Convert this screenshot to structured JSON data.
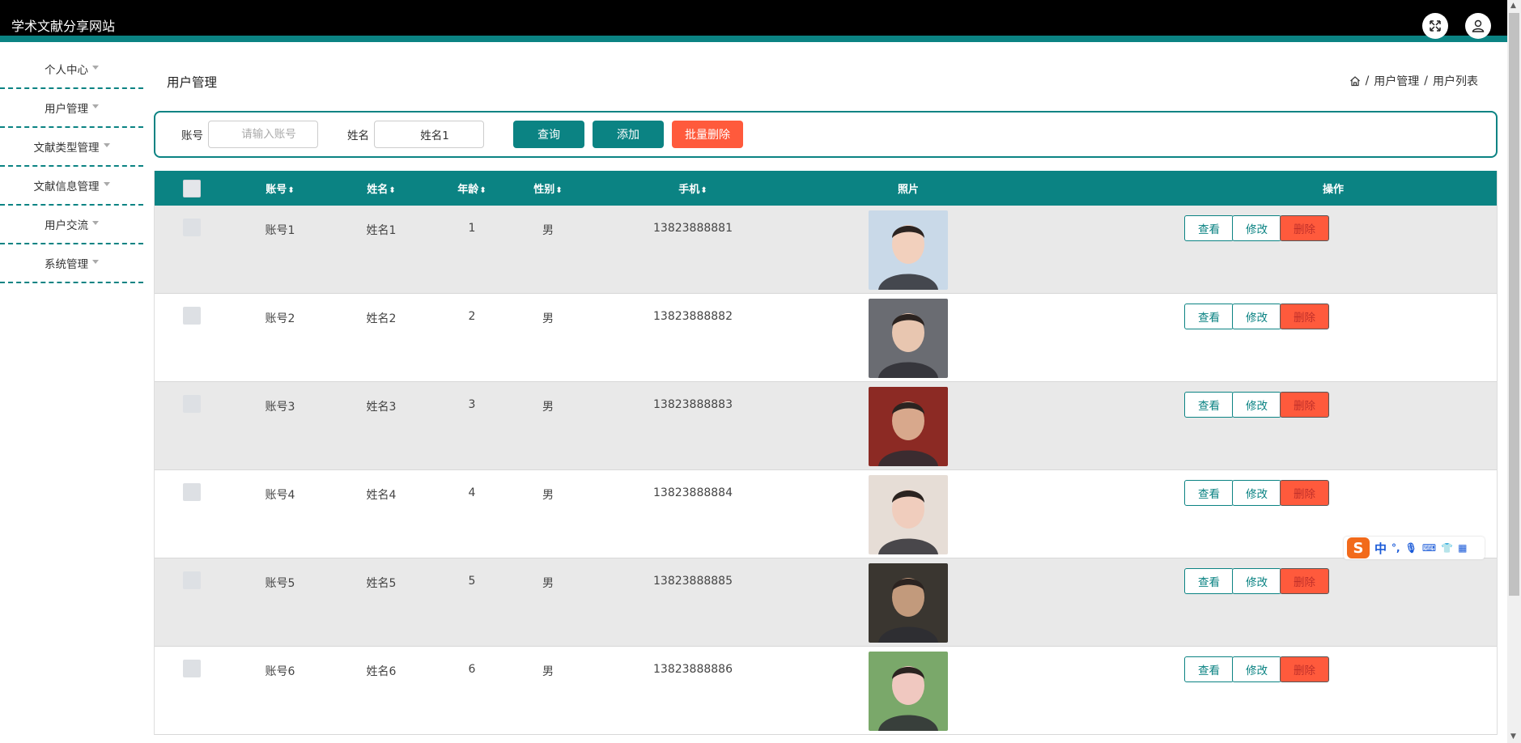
{
  "app": {
    "title": "学术文献分享网站"
  },
  "sidebar": {
    "items": [
      {
        "label": "个人中心"
      },
      {
        "label": "用户管理"
      },
      {
        "label": "文献类型管理"
      },
      {
        "label": "文献信息管理"
      },
      {
        "label": "用户交流"
      },
      {
        "label": "系统管理"
      }
    ]
  },
  "page": {
    "title": "用户管理",
    "breadcrumb": {
      "sep": "/",
      "level1": "用户管理",
      "level2": "用户列表"
    }
  },
  "search": {
    "account_label": "账号",
    "account_placeholder": "请输入账号",
    "account_value": "",
    "name_label": "姓名",
    "name_value": "姓名1",
    "query_btn": "查询",
    "add_btn": "添加",
    "batch_delete_btn": "批量删除"
  },
  "table": {
    "headers": {
      "account": "账号",
      "name": "姓名",
      "age": "年龄",
      "gender": "性别",
      "phone": "手机",
      "photo": "照片",
      "actions": "操作"
    },
    "sort_icon": "⬍",
    "rows": [
      {
        "account": "账号1",
        "name": "姓名1",
        "age": "1",
        "gender": "男",
        "phone": "13823888881",
        "photo_bg": "#c9d9e8",
        "photo_fg": "#f2d0bd"
      },
      {
        "account": "账号2",
        "name": "姓名2",
        "age": "2",
        "gender": "男",
        "phone": "13823888882",
        "photo_bg": "#6a6c72",
        "photo_fg": "#e8c6b0"
      },
      {
        "account": "账号3",
        "name": "姓名3",
        "age": "3",
        "gender": "男",
        "phone": "13823888883",
        "photo_bg": "#8c2a24",
        "photo_fg": "#d8a88c"
      },
      {
        "account": "账号4",
        "name": "姓名4",
        "age": "4",
        "gender": "男",
        "phone": "13823888884",
        "photo_bg": "#e6ddd6",
        "photo_fg": "#f0cdbd"
      },
      {
        "account": "账号5",
        "name": "姓名5",
        "age": "5",
        "gender": "男",
        "phone": "13823888885",
        "photo_bg": "#3a3630",
        "photo_fg": "#c29a7c"
      },
      {
        "account": "账号6",
        "name": "姓名6",
        "age": "6",
        "gender": "男",
        "phone": "13823888886",
        "photo_bg": "#7aa86a",
        "photo_fg": "#f0c8c0"
      }
    ],
    "actions": {
      "view": "查看",
      "edit": "修改",
      "delete": "删除"
    }
  },
  "ime": {
    "logo": "S",
    "label": "中"
  },
  "colors": {
    "accent": "#0b8383",
    "danger": "#ff5a3c",
    "header": "#000000"
  }
}
